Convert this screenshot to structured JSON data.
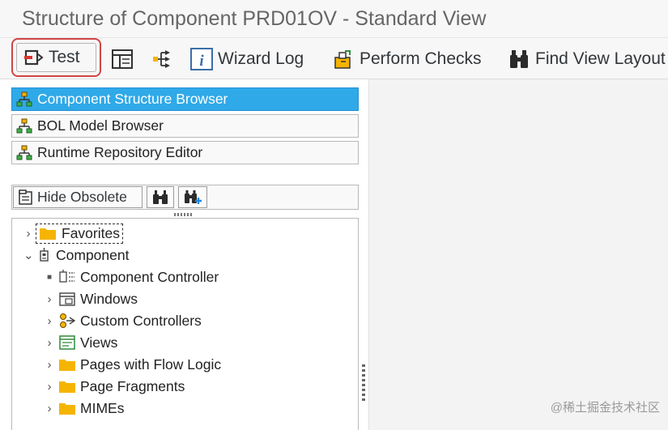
{
  "window": {
    "title": "Structure of Component PRD01OV - Standard View"
  },
  "toolbar": {
    "test_label": "Test",
    "wizard_log_label": "Wizard Log",
    "perform_checks_label": "Perform Checks",
    "find_view_layout_label": "Find View Layout"
  },
  "nav": {
    "component_structure_browser": "Component Structure Browser",
    "bol_model_browser": "BOL Model Browser",
    "runtime_repository_editor": "Runtime Repository Editor"
  },
  "tree_toolbar": {
    "hide_obsolete_label": "Hide Obsolete"
  },
  "tree": {
    "favorites": "Favorites",
    "component": "Component",
    "component_controller": "Component Controller",
    "windows": "Windows",
    "custom_controllers": "Custom Controllers",
    "views": "Views",
    "pages_with_flow_logic": "Pages with Flow Logic",
    "page_fragments": "Page Fragments",
    "mimes": "MIMEs"
  },
  "watermark": "@稀土掘金技术社区",
  "colors": {
    "active_nav": "#2fa9e8",
    "folder": "#f5b400",
    "highlight_border": "#d04545"
  }
}
